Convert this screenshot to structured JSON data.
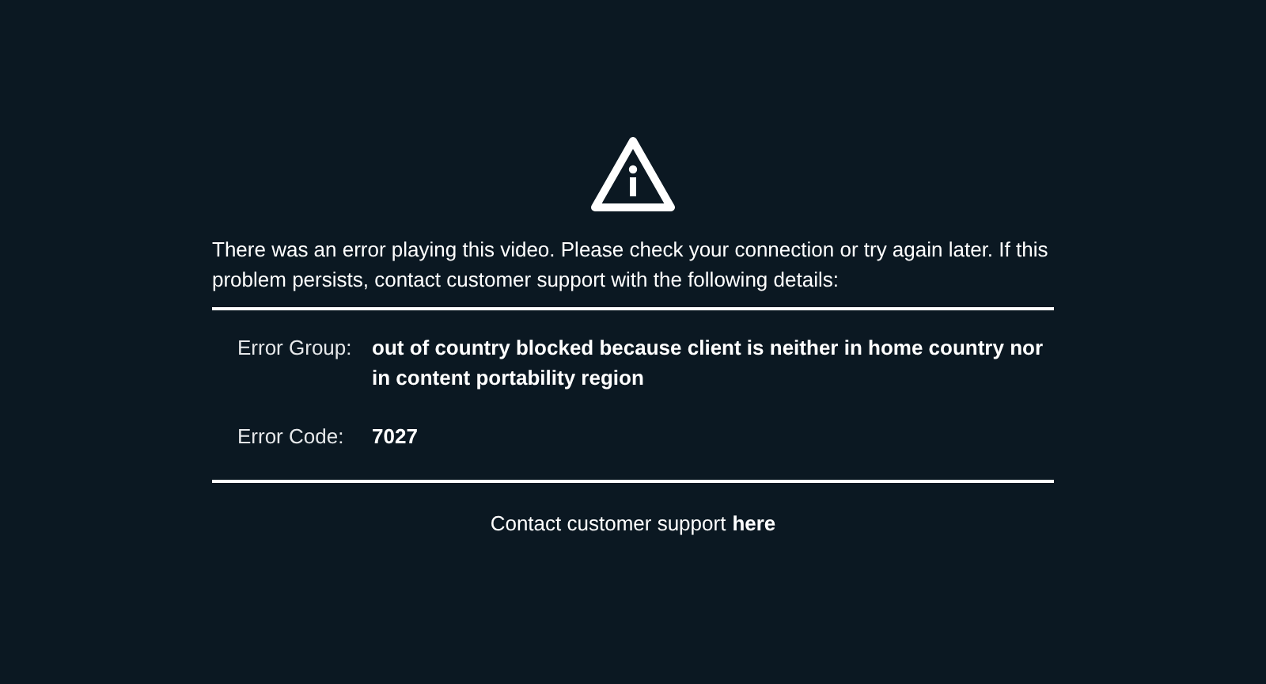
{
  "message": "There was an error playing this video. Please check your connection or try again later. If this problem persists, contact customer support with the following details:",
  "details": [
    {
      "label": "Error Group:",
      "value": "out of country blocked because client is neither in home country nor in content portability region"
    },
    {
      "label": "Error Code:",
      "value": "7027"
    }
  ],
  "contact": {
    "text": "Contact customer support",
    "link": "here"
  }
}
